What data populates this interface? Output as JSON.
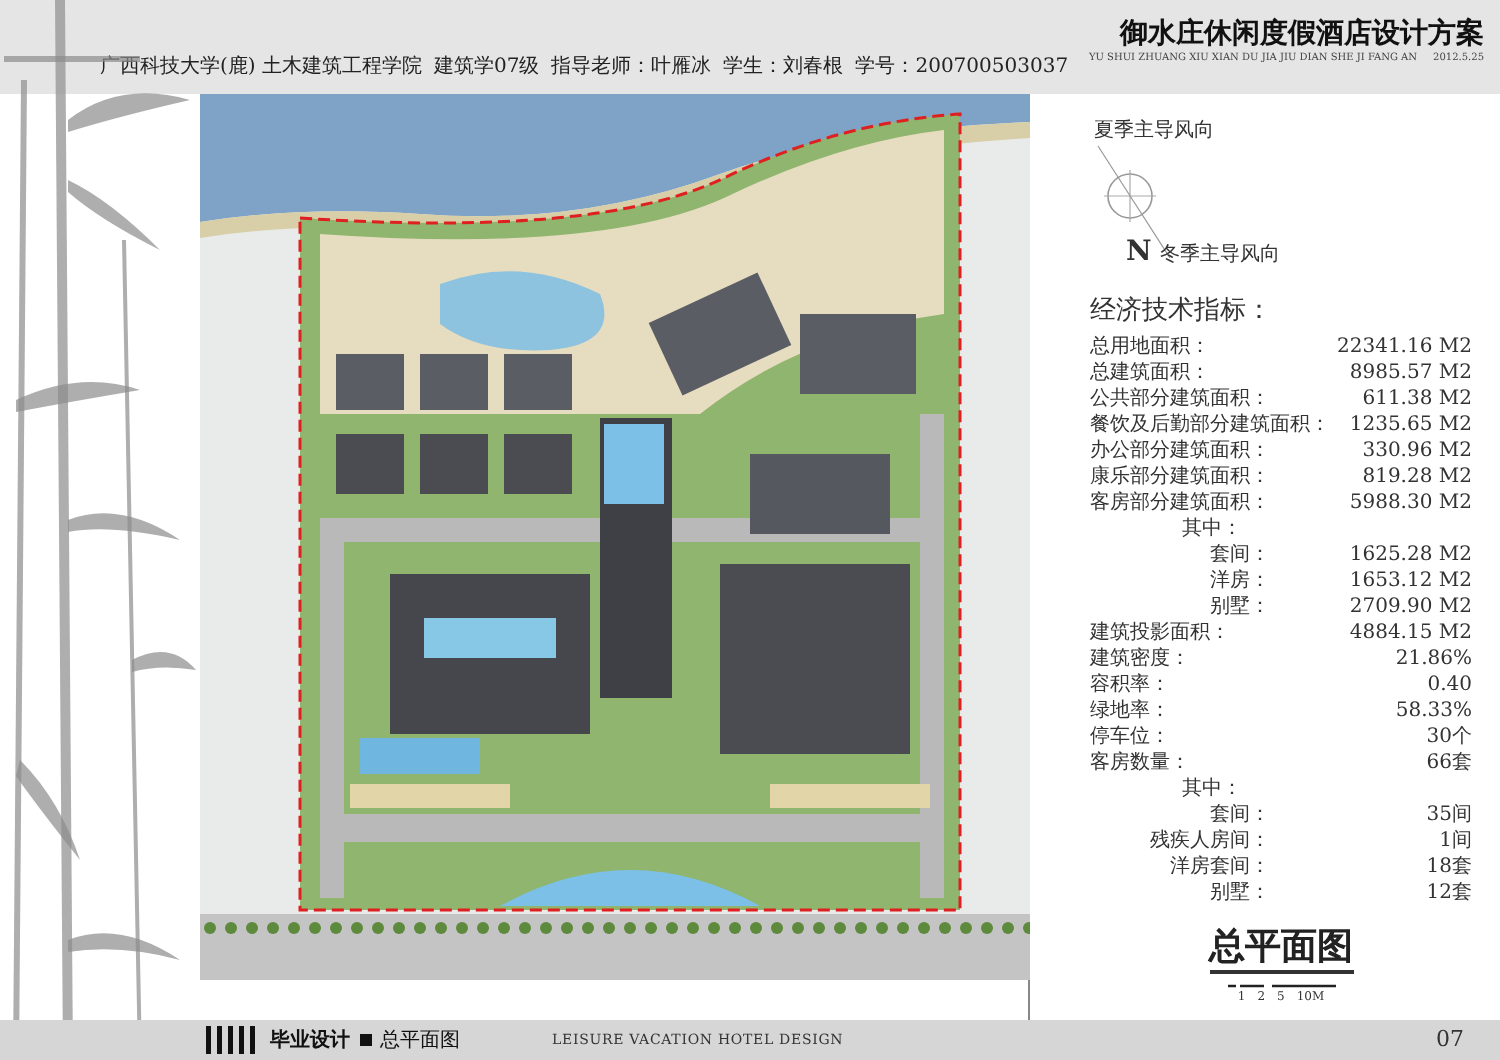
{
  "header": {
    "school": "广西科技大学(鹿) 土木建筑工程学院",
    "class": "建筑学07级",
    "advisor": "指导老师：叶雁冰",
    "student": "学生：刘春根",
    "student_id": "学号：200700503037",
    "title": "御水庄休闲度假酒店设计方案",
    "title_pinyin": "YU SHUI ZHUANG XIU XIAN DU JIA JIU DIAN SHE JI FANG AN",
    "date": "2012.5.25"
  },
  "compass": {
    "north": "N",
    "summer_wind": "夏季主导风向",
    "winter_wind": "冬季主导风向"
  },
  "indicators": {
    "title": "经济技术指标：",
    "items": [
      {
        "label": "总用地面积：",
        "value": "22341.16 M2"
      },
      {
        "label": "总建筑面积：",
        "value": "8985.57 M2"
      },
      {
        "label": "公共部分建筑面积：",
        "value": "611.38 M2"
      },
      {
        "label": "餐饮及后勤部分建筑面积：",
        "value": "1235.65 M2"
      },
      {
        "label": "办公部分建筑面积：",
        "value": "330.96 M2"
      },
      {
        "label": "康乐部分建筑面积：",
        "value": "819.28 M2"
      },
      {
        "label": "客房部分建筑面积：",
        "value": "5988.30 M2"
      },
      {
        "label": "其中：",
        "children": [
          {
            "label": "套间：",
            "value": "1625.28 M2"
          },
          {
            "label": "洋房：",
            "value": "1653.12 M2"
          },
          {
            "label": "别墅：",
            "value": "2709.90 M2"
          }
        ]
      },
      {
        "label": "建筑投影面积：",
        "value": "4884.15 M2"
      },
      {
        "label": "建筑密度：",
        "value": "21.86%"
      },
      {
        "label": "容积率：",
        "value": "0.40"
      },
      {
        "label": "绿地率：",
        "value": "58.33%"
      },
      {
        "label": "停车位：",
        "value": "30个"
      },
      {
        "label": "客房数量：",
        "value": "66套"
      },
      {
        "label": "其中：",
        "children": [
          {
            "label": "套间：",
            "value": "35间"
          },
          {
            "label": "残疾人房间：",
            "value": "1间"
          },
          {
            "label": "洋房套间：",
            "value": "18套"
          },
          {
            "label": "别墅：",
            "value": "12套"
          }
        ]
      }
    ]
  },
  "drawing_title": "总平面图",
  "scale_labels": [
    "1",
    "2",
    "5",
    "10M"
  ],
  "footer": {
    "label": "毕业设计",
    "sheet": "总平面图",
    "english": "LEISURE VACATION HOTEL DESIGN",
    "page": "07"
  }
}
